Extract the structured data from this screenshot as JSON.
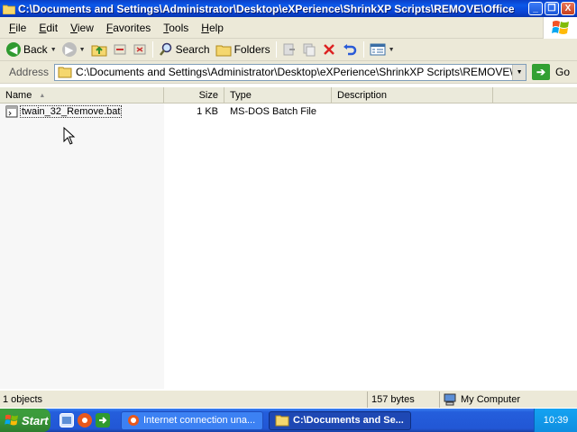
{
  "window": {
    "title": "C:\\Documents and Settings\\Administrator\\Desktop\\eXPerience\\ShrinkXP Scripts\\REMOVE\\Office",
    "controls": {
      "minimize": "_",
      "maximize": "❐",
      "close": "X"
    }
  },
  "menu": {
    "items": [
      "File",
      "Edit",
      "View",
      "Favorites",
      "Tools",
      "Help"
    ]
  },
  "toolbar": {
    "back_label": "Back",
    "search_label": "Search",
    "folders_label": "Folders"
  },
  "address": {
    "label": "Address",
    "value": "C:\\Documents and Settings\\Administrator\\Desktop\\eXPerience\\ShrinkXP Scripts\\REMOVE\\Office",
    "go_label": "Go"
  },
  "list": {
    "columns": [
      "Name",
      "Size",
      "Type",
      "Description"
    ],
    "rows": [
      {
        "name": "twain_32_Remove.bat",
        "size": "1 KB",
        "type": "MS-DOS Batch File",
        "description": ""
      }
    ]
  },
  "status": {
    "objects": "1 objects",
    "bytes": "157 bytes",
    "location": "My Computer"
  },
  "taskbar": {
    "start_label": "Start",
    "tasks": [
      {
        "label": "Internet connection una..."
      },
      {
        "label": "C:\\Documents and Se..."
      }
    ],
    "clock": "10:39"
  }
}
